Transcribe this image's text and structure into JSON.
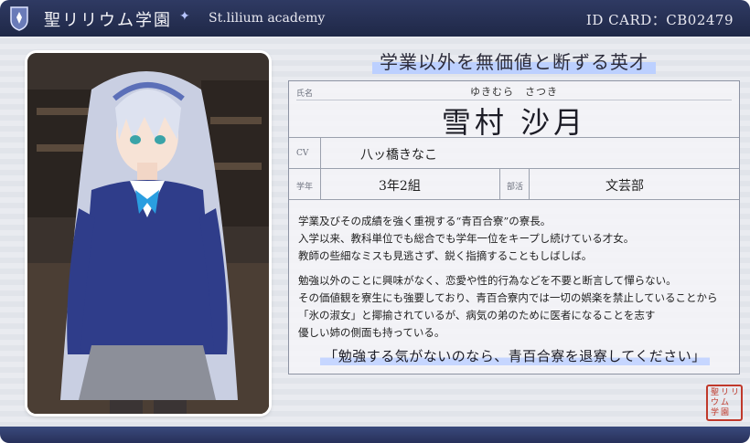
{
  "header": {
    "school_name": "聖リリウム学園",
    "star": "✦",
    "academy": "St.lilium academy",
    "id_card": "ID CARD：CB02479"
  },
  "tagline": "学業以外を無価値と断ずる英才",
  "profile": {
    "name_label": "氏名",
    "furigana": "ゆきむら　さつき",
    "name": "雪村 沙月",
    "cv_label": "CV",
    "cv": "八ッ橋きなこ",
    "grade_label": "学年",
    "grade": "3年2組",
    "club_label": "部活",
    "club": "文芸部"
  },
  "description": {
    "p1": [
      "学業及びその成績を強く重視する“青百合寮”の寮長。",
      "入学以来、教科単位でも総合でも学年一位をキープし続けている才女。",
      "教師の些細なミスも見逃さず、鋭く指摘することもしばしば。"
    ],
    "p2": [
      "勉強以外のことに興味がなく、恋愛や性的行為などを不要と断言して憚らない。",
      "その価値観を寮生にも強要しており、青百合寮内では一切の娯楽を禁止していることから",
      "「氷の淑女」と揶揄されているが、病気の弟のために医者になることを志す",
      "優しい姉の側面も持っている。"
    ]
  },
  "quote": "「勉強する気がないのなら、青百合寮を退寮してください」",
  "seal": {
    "chars": [
      "聖",
      "リ",
      "リ",
      "ウ",
      "ム",
      "学",
      "園"
    ]
  },
  "colors": {
    "header": "#27305a",
    "accent": "#bcd0ff",
    "seal": "#c0392b"
  }
}
